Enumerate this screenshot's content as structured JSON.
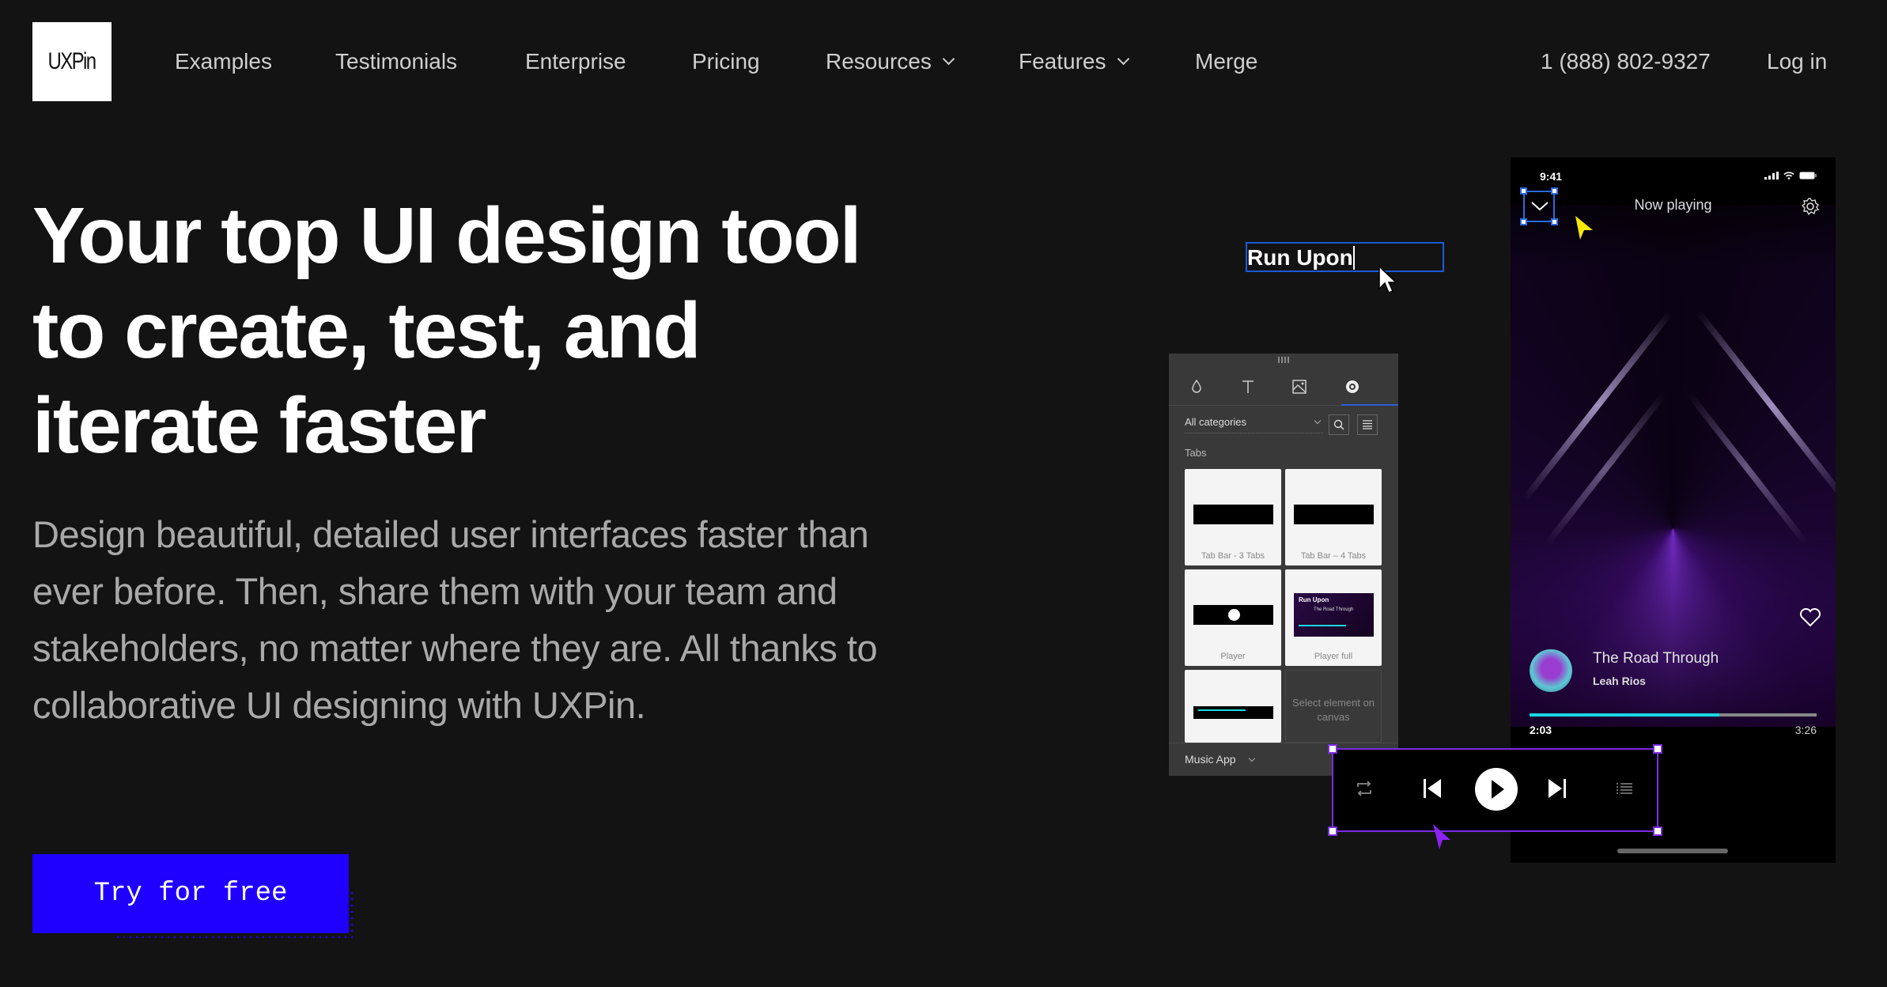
{
  "nav": {
    "logo": "UXPin",
    "items": [
      {
        "label": "Examples",
        "dropdown": false
      },
      {
        "label": "Testimonials",
        "dropdown": false
      },
      {
        "label": "Enterprise",
        "dropdown": false
      },
      {
        "label": "Pricing",
        "dropdown": false
      },
      {
        "label": "Resources",
        "dropdown": true
      },
      {
        "label": "Features",
        "dropdown": true
      },
      {
        "label": "Merge",
        "dropdown": false
      }
    ],
    "phone": "1 (888) 802-9327",
    "login": "Log in"
  },
  "hero": {
    "headline_lines": [
      "Your top UI design tool",
      "to create, test, and",
      "iterate faster"
    ],
    "subtext": "Design beautiful, detailed user interfaces faster than ever before. Then, share them with your team and stakeholders, no matter where they are. All thanks to collaborative UI designing with UXPin.",
    "cta": "Try for free",
    "cta_color": "#1f00ff"
  },
  "canvas": {
    "text_box_value": "Run Upon",
    "panel": {
      "tools": [
        "color-drop-icon",
        "text-icon",
        "image-icon",
        "components-icon"
      ],
      "category_select": "All categories",
      "section_title": "Tabs",
      "cards": [
        {
          "label": "Tab Bar - 3 Tabs"
        },
        {
          "label": "Tab Bar – 4 Tabs"
        },
        {
          "label": "Player"
        },
        {
          "label": "Player full",
          "thumb_title": "Run Upon",
          "thumb_song": "The Road Through"
        },
        {
          "label": ""
        },
        {
          "label": "Select element on canvas",
          "empty": true
        }
      ],
      "library": "Music App"
    },
    "phone": {
      "time": "9:41",
      "title": "Now playing",
      "song": "The Road Through",
      "artist": "Leah Rios",
      "current_time": "2:03",
      "total_time": "3:26",
      "progress": 0.66
    },
    "player_controls": [
      "repeat-icon",
      "previous-icon",
      "play-icon",
      "next-icon",
      "queue-icon"
    ]
  }
}
